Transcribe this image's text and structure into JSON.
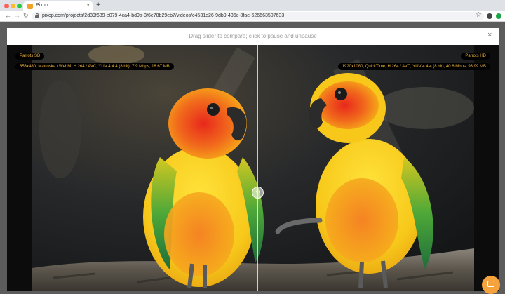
{
  "browser": {
    "tab_title": "Pixop",
    "tab_close": "×",
    "new_tab": "+",
    "url": "pixop.com/projects/2d39f639-e079-4ca4-bd9a-3f6e78b29eb7/videos/c4531e26-9db9-436c-8fae-626663507633",
    "nav": {
      "back": "←",
      "forward": "→",
      "reload": "↻"
    },
    "star": "☆"
  },
  "modal": {
    "instruction": "Drag slider to compare; click to pause and unpause",
    "close": "×",
    "left": {
      "label": "Parrots SD",
      "info": "853x480, Matroska / WebM, H.264 / AVC, YUV 4:4:4 (8 bit), 7.9 Mbps, 18.67 MB"
    },
    "right": {
      "label": "Parrots HD",
      "info": "1920x1080, QuickTime, H.264 / AVC, YUV 4:4:4 (8 bit), 40.6 Mbps, 93.99 MB"
    },
    "slider_arrows": "‹ ›",
    "slider_position": 0.5
  },
  "colors": {
    "badge_text": "#f0b43c",
    "chat_button": "#f5a33c",
    "parrot_yellow": "#f7c81a",
    "parrot_orange": "#f07a20"
  }
}
